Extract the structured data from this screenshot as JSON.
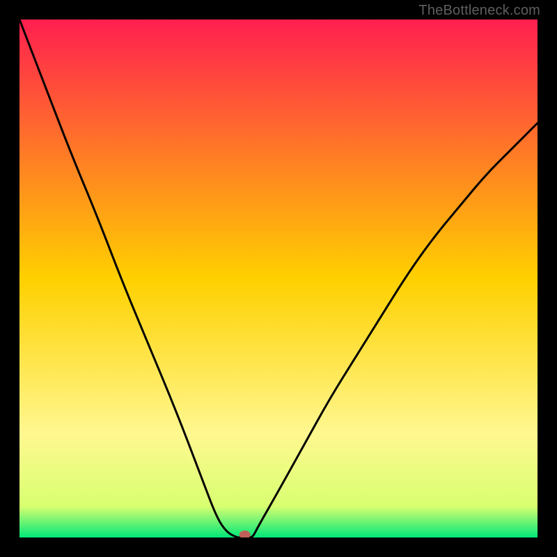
{
  "watermark": "TheBottleneck.com",
  "chart_data": {
    "type": "line",
    "title": "",
    "xlabel": "",
    "ylabel": "",
    "xlim": [
      0,
      100
    ],
    "ylim": [
      0,
      100
    ],
    "x": [
      0,
      5,
      10,
      15,
      20,
      25,
      30,
      35,
      38,
      40,
      42,
      43,
      44,
      45,
      46,
      50,
      55,
      60,
      65,
      70,
      75,
      80,
      85,
      90,
      95,
      100
    ],
    "y": [
      100,
      87,
      74,
      62,
      49,
      37,
      25,
      12,
      4,
      1,
      0,
      0,
      0,
      0,
      2,
      9,
      18,
      27,
      35,
      43,
      51,
      58,
      64,
      70,
      75,
      80
    ],
    "marker": {
      "x": 43.5,
      "y": 0
    },
    "background_gradient": {
      "stops": [
        {
          "offset": 0,
          "color": "#ff1f4f"
        },
        {
          "offset": 50,
          "color": "#ffd000"
        },
        {
          "offset": 80,
          "color": "#fff890"
        },
        {
          "offset": 94,
          "color": "#d8ff70"
        },
        {
          "offset": 100,
          "color": "#00e878"
        }
      ]
    }
  }
}
